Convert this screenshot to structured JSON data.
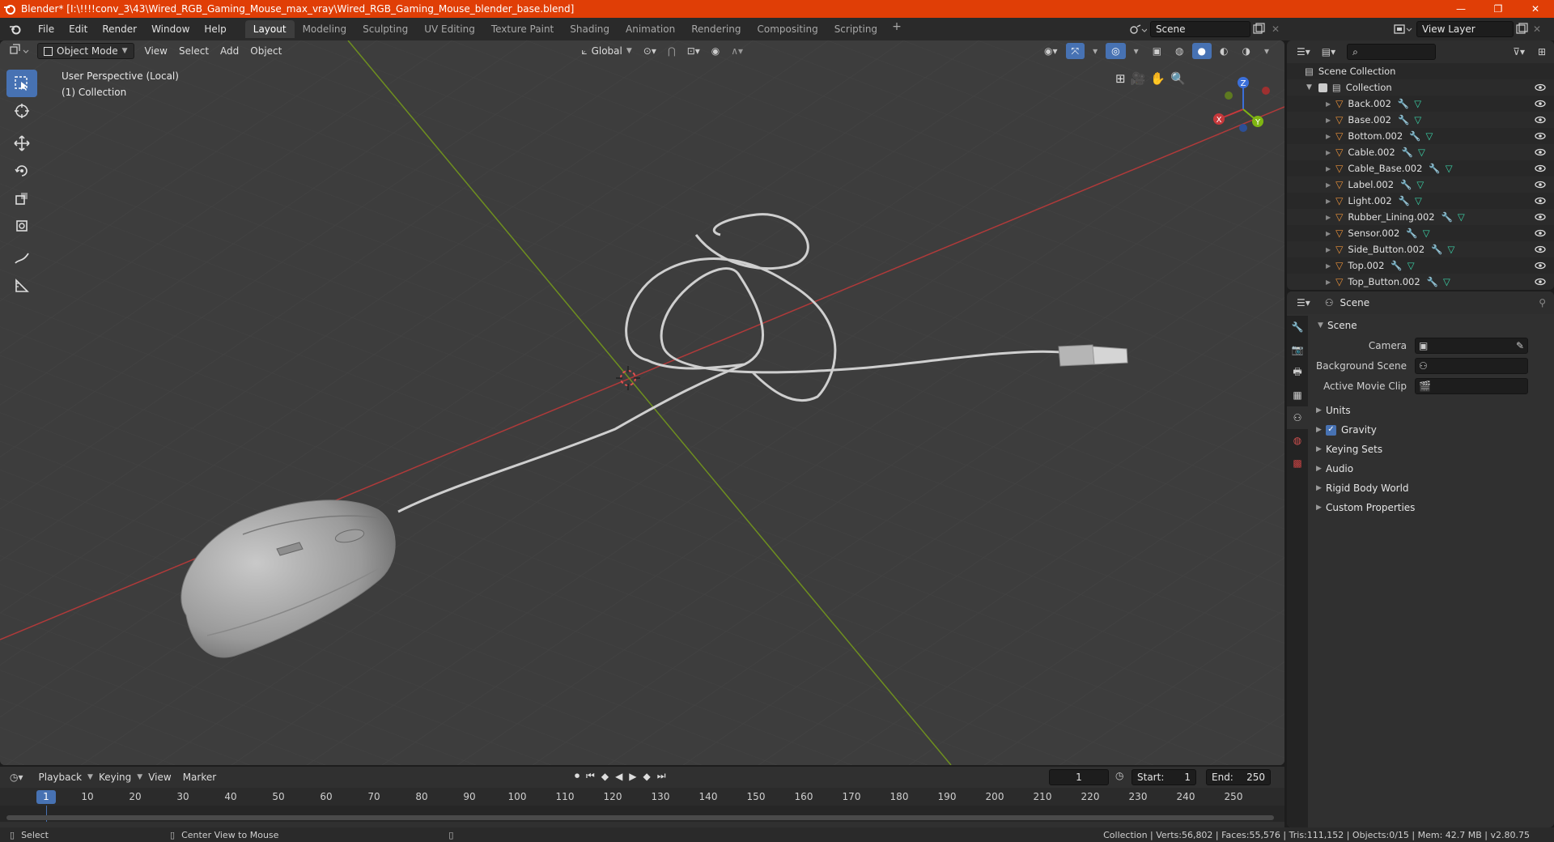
{
  "window": {
    "title": "Blender* [I:\\!!!!conv_3\\43\\Wired_RGB_Gaming_Mouse_max_vray\\Wired_RGB_Gaming_Mouse_blender_base.blend]",
    "minimize": "—",
    "maximize": "❐",
    "close": "✕"
  },
  "menu": [
    "File",
    "Edit",
    "Render",
    "Window",
    "Help"
  ],
  "workspaces": [
    "Layout",
    "Modeling",
    "Sculpting",
    "UV Editing",
    "Texture Paint",
    "Shading",
    "Animation",
    "Rendering",
    "Compositing",
    "Scripting"
  ],
  "active_workspace": "Layout",
  "scene_field": "Scene",
  "view_layer_field": "View Layer",
  "viewport": {
    "mode": "Object Mode",
    "menus": [
      "View",
      "Select",
      "Add",
      "Object"
    ],
    "orientation": "Global",
    "info_line1": "User Perspective (Local)",
    "info_line2": "(1) Collection",
    "gizmo_axes": [
      "X",
      "Y",
      "Z"
    ],
    "colors": {
      "x_axis": "#b03a3a",
      "y_axis": "#6e8f1f",
      "bg": "#3d3d3d"
    }
  },
  "timeline": {
    "menus": [
      "Playback",
      "Keying",
      "View",
      "Marker"
    ],
    "current_frame": "1",
    "start_label": "Start:",
    "start": "1",
    "end_label": "End:",
    "end": "250",
    "ticks": [
      "10",
      "20",
      "30",
      "40",
      "50",
      "60",
      "70",
      "80",
      "90",
      "100",
      "110",
      "120",
      "130",
      "140",
      "150",
      "160",
      "170",
      "180",
      "190",
      "200",
      "210",
      "220",
      "230",
      "240",
      "250"
    ]
  },
  "statusbar": {
    "left_action": "Select",
    "mid_action": "Center View to Mouse",
    "stats": "Collection | Verts:56,802 | Faces:55,576 | Tris:111,152 | Objects:0/15 | Mem: 42.7 MB | v2.80.75"
  },
  "outliner": {
    "root": "Scene Collection",
    "collection": "Collection",
    "items": [
      "Back.002",
      "Base.002",
      "Bottom.002",
      "Cable.002",
      "Cable_Base.002",
      "Label.002",
      "Light.002",
      "Rubber_Lining.002",
      "Sensor.002",
      "Side_Button.002",
      "Top.002",
      "Top_Button.002"
    ]
  },
  "properties": {
    "header": "Scene",
    "panel": "Scene",
    "camera_label": "Camera",
    "background_scene_label": "Background Scene",
    "active_movie_clip_label": "Active Movie Clip",
    "subpanels": {
      "units": "Units",
      "gravity": "Gravity",
      "keying_sets": "Keying Sets",
      "audio": "Audio",
      "rigid_body_world": "Rigid Body World",
      "custom_properties": "Custom Properties"
    },
    "gravity_checked": true
  }
}
